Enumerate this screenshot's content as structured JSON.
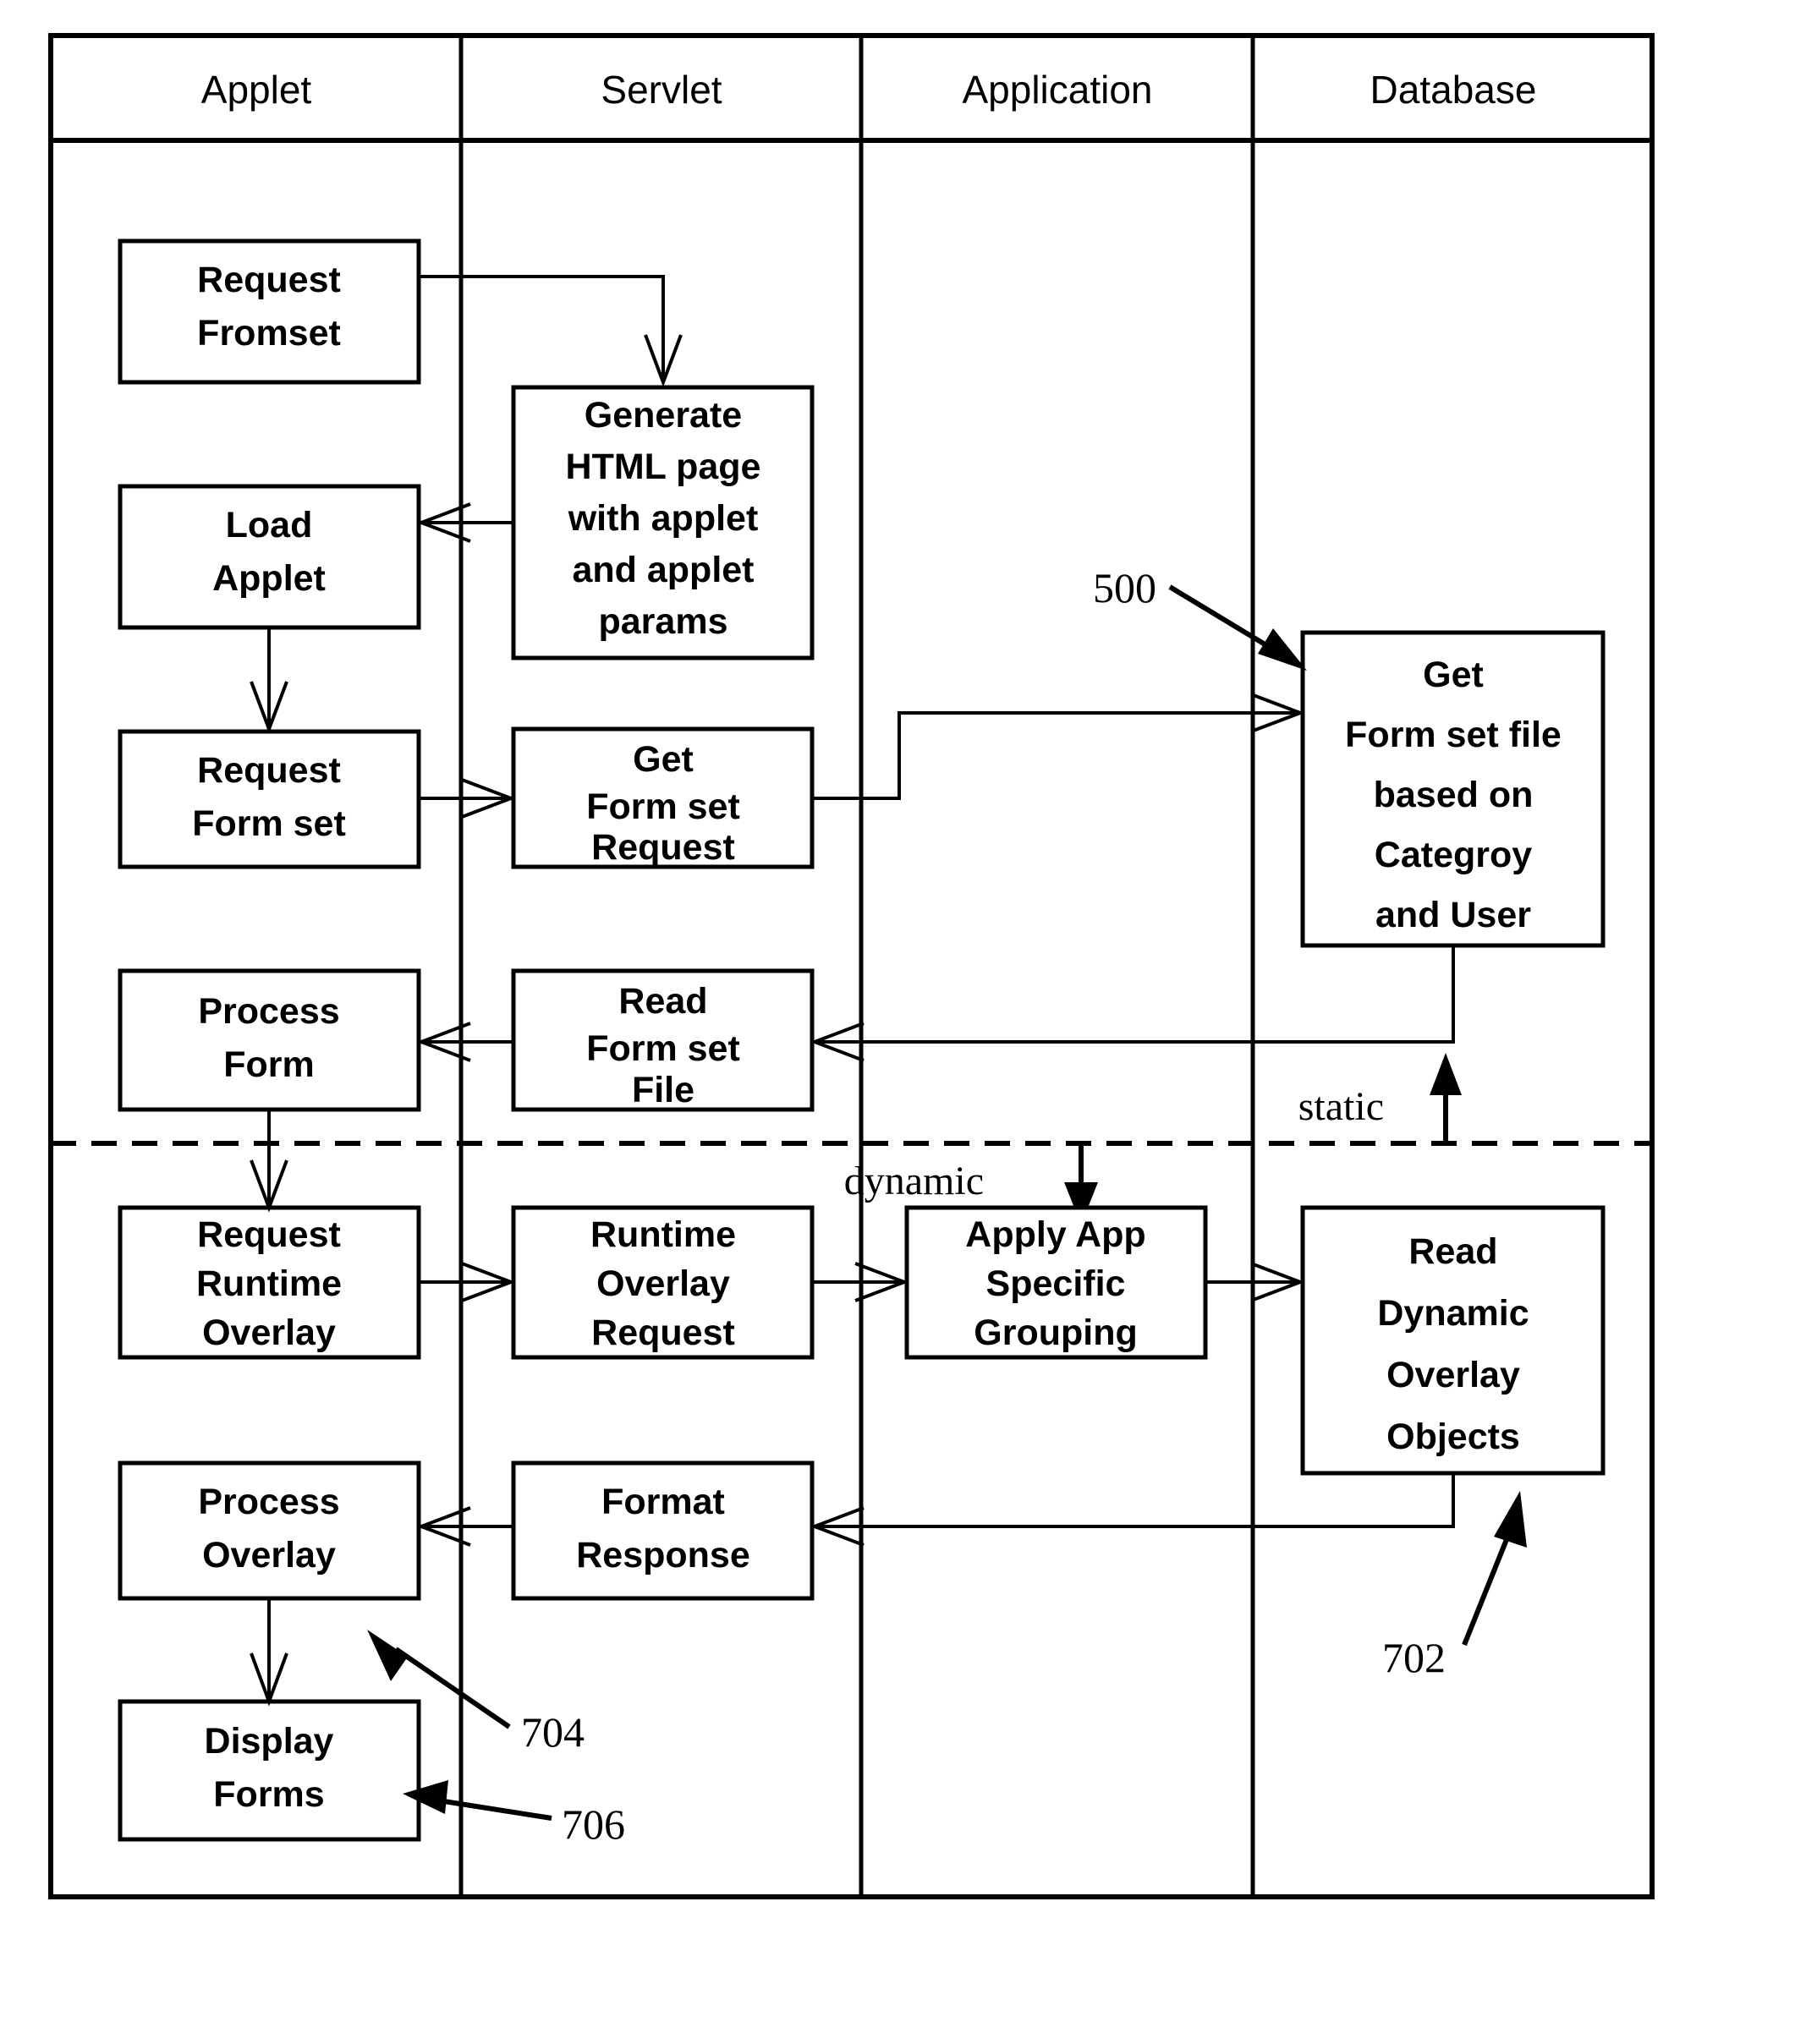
{
  "diagram": {
    "type": "swimlane-flowchart",
    "columns": [
      {
        "id": "applet",
        "label": "Applet"
      },
      {
        "id": "servlet",
        "label": "Servlet"
      },
      {
        "id": "application",
        "label": "Application"
      },
      {
        "id": "database",
        "label": "Database"
      }
    ],
    "phase_labels": [
      {
        "id": "static",
        "label": "static",
        "direction": "up"
      },
      {
        "id": "dynamic",
        "label": "dynamic",
        "direction": "down"
      }
    ],
    "nodes": [
      {
        "id": "request-fromset",
        "column": "applet",
        "lines": [
          "Request",
          "Fromset"
        ]
      },
      {
        "id": "load-applet",
        "column": "applet",
        "lines": [
          "Load",
          "Applet"
        ]
      },
      {
        "id": "request-form-set",
        "column": "applet",
        "lines": [
          "Request",
          "Form set"
        ]
      },
      {
        "id": "process-form",
        "column": "applet",
        "lines": [
          "Process",
          "Form"
        ]
      },
      {
        "id": "request-runtime-overlay",
        "column": "applet",
        "lines": [
          "Request",
          "Runtime",
          "Overlay"
        ]
      },
      {
        "id": "process-overlay",
        "column": "applet",
        "lines": [
          "Process",
          "Overlay"
        ]
      },
      {
        "id": "display-forms",
        "column": "applet",
        "lines": [
          "Display",
          "Forms"
        ]
      },
      {
        "id": "generate-html-page",
        "column": "servlet",
        "lines": [
          "Generate",
          "HTML page",
          "with applet",
          "and applet",
          "params"
        ]
      },
      {
        "id": "get-form-set-request",
        "column": "servlet",
        "lines": [
          "Get",
          "Form set",
          "Request"
        ]
      },
      {
        "id": "read-form-set-file",
        "column": "servlet",
        "lines": [
          "Read",
          "Form set",
          "File"
        ]
      },
      {
        "id": "runtime-overlay-request",
        "column": "servlet",
        "lines": [
          "Runtime",
          "Overlay",
          "Request"
        ]
      },
      {
        "id": "format-response",
        "column": "servlet",
        "lines": [
          "Format",
          "Response"
        ]
      },
      {
        "id": "apply-app-specific-grouping",
        "column": "application",
        "lines": [
          "Apply App",
          "Specific",
          "Grouping"
        ]
      },
      {
        "id": "get-form-set-file",
        "column": "database",
        "lines": [
          "Get",
          "Form set file",
          "based on",
          "Categroy",
          "and User"
        ]
      },
      {
        "id": "read-dynamic-overlay-objects",
        "column": "database",
        "lines": [
          "Read",
          "Dynamic",
          "Overlay",
          "Objects"
        ]
      }
    ],
    "reference_numerals": [
      {
        "id": "ref-500",
        "label": "500",
        "points_to": "get-form-set-file"
      },
      {
        "id": "ref-702",
        "label": "702",
        "points_to": "read-dynamic-overlay-objects"
      },
      {
        "id": "ref-704",
        "label": "704",
        "points_to": "process-overlay"
      },
      {
        "id": "ref-706",
        "label": "706",
        "points_to": "display-forms"
      }
    ]
  }
}
